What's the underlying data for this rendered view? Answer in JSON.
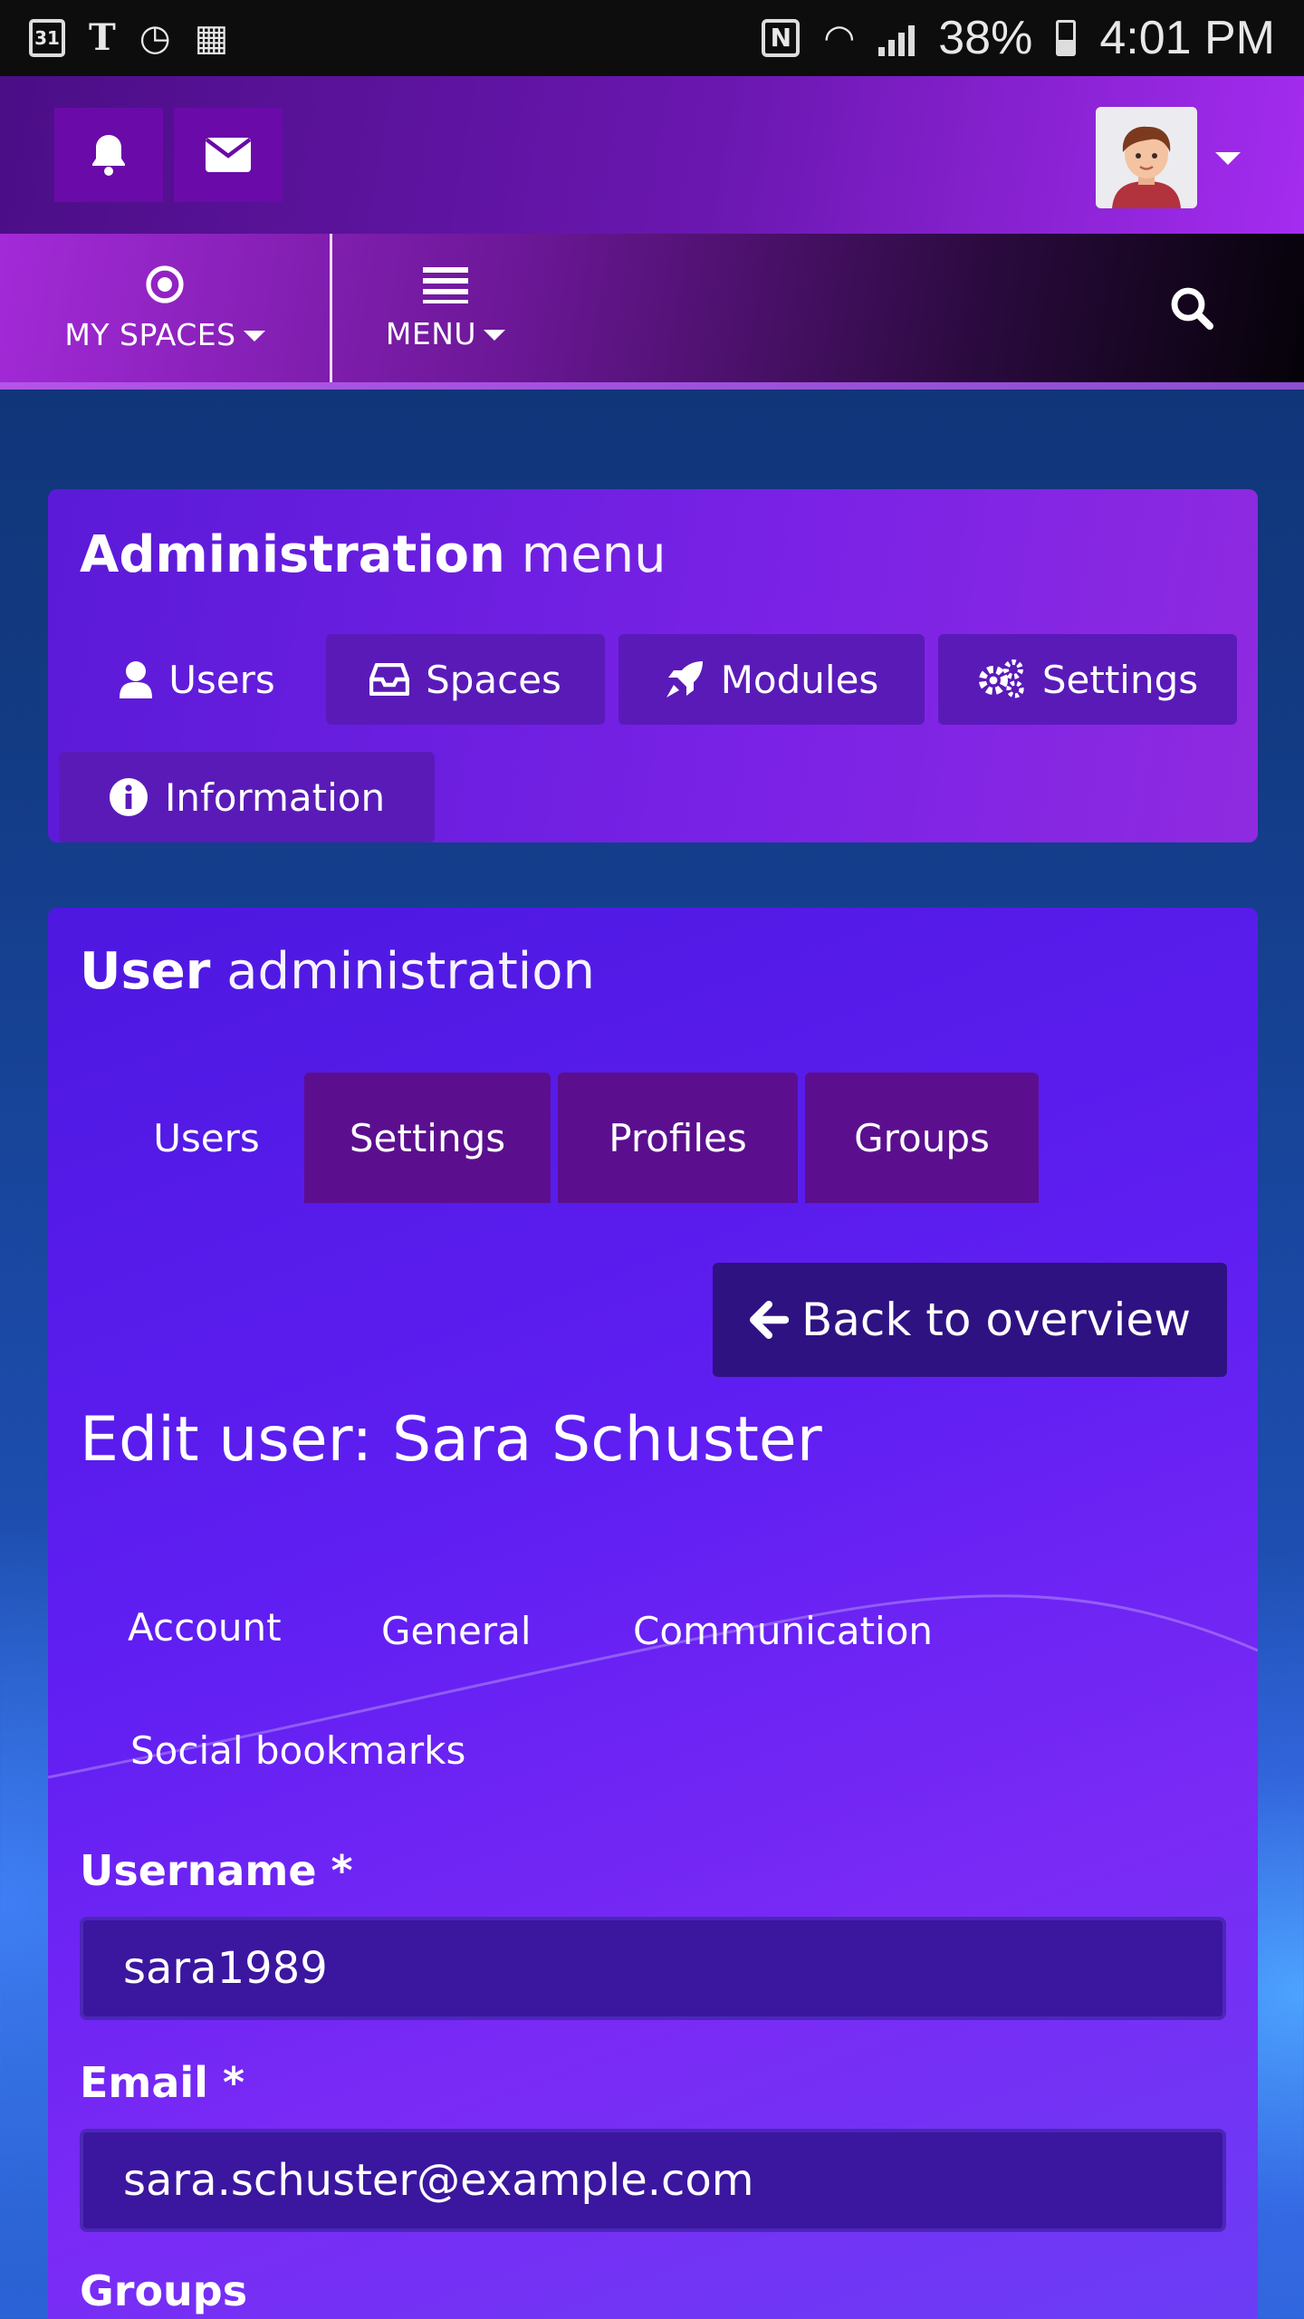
{
  "status_bar": {
    "calendar_day": "31",
    "carrier_icon": "T",
    "battery": "38%",
    "time": "4:01 PM"
  },
  "header": {
    "notifications_icon": "bell-icon",
    "messages_icon": "envelope-icon",
    "avatar_icon": "user-avatar"
  },
  "nav": {
    "my_spaces": "MY SPACES",
    "menu": "MENU",
    "search_icon": "search-icon"
  },
  "admin_menu": {
    "title_bold": "Administration",
    "title_light": "menu",
    "items": [
      {
        "label": "Users",
        "icon": "user-icon"
      },
      {
        "label": "Spaces",
        "icon": "inbox-icon"
      },
      {
        "label": "Modules",
        "icon": "rocket-icon"
      },
      {
        "label": "Settings",
        "icon": "gears-icon"
      },
      {
        "label": "Information",
        "icon": "info-icon"
      }
    ]
  },
  "user_admin": {
    "title_bold": "User",
    "title_light": "administration",
    "tabs": [
      "Users",
      "Settings",
      "Profiles",
      "Groups"
    ],
    "back_button": "Back to overview",
    "edit_title": "Edit user: Sara Schuster",
    "subtabs": [
      "Account",
      "General",
      "Communication",
      "Social bookmarks"
    ],
    "fields": {
      "username_label": "Username *",
      "username_value": "sara1989",
      "email_label": "Email *",
      "email_value": "sara.schuster@example.com",
      "groups_label": "Groups"
    }
  },
  "colors": {
    "header_gradient_start": "#4b0e86",
    "header_gradient_end": "#a42cf0",
    "panel": "#5f1ef2",
    "dark_tab": "#5b0f8e",
    "back_button": "#2e1282",
    "input_bg": "#3b169f"
  }
}
